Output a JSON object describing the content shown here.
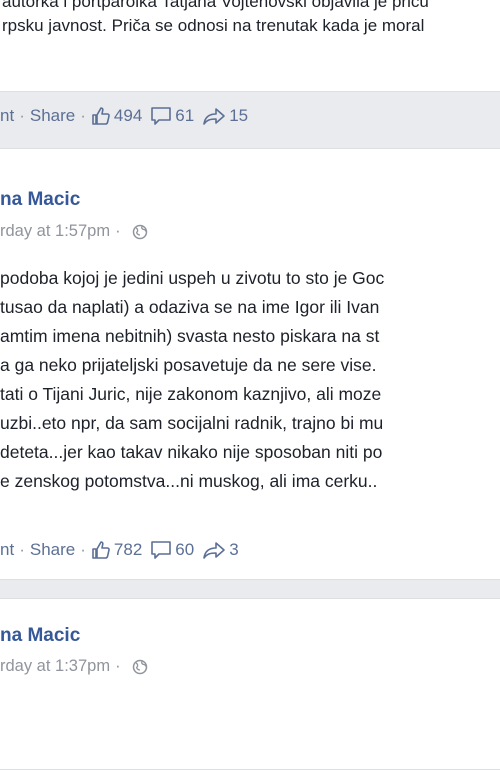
{
  "post_top": {
    "lines": [
      "autorka i portparolka Tatjana Vojtehovski objavila je priču",
      "rpsku javnost. Priča se odnosi na trenutak kada je moral"
    ],
    "actions": {
      "comment_tail": "nt",
      "share": "Share"
    },
    "likes": "494",
    "comments": "61",
    "shares": "15"
  },
  "comment_1": {
    "author": "na Macic",
    "time": "rday at 1:57pm",
    "lines": [
      "podoba kojoj je jedini uspeh u zivotu to sto je Goc",
      "tusao da naplati) a odaziva se na ime Igor ili Ivan",
      "amtim imena nebitnih) svasta nesto piskara na st",
      "a ga neko prijateljski posavetuje da ne sere vise.",
      "tati o Tijani Juric, nije zakonom kaznjivo, ali moze",
      "uzbi..eto npr, da sam socijalni radnik, trajno bi mu",
      "deteta...jer kao takav nikako nije sposoban niti po",
      "e zenskog potomstva...ni muskog, ali ima cerku.."
    ],
    "actions": {
      "comment_tail": "nt",
      "share": "Share"
    },
    "likes": "782",
    "comments": "60",
    "shares": "3"
  },
  "comment_2": {
    "author": "na Macic",
    "time": "rday at 1:37pm"
  },
  "colors": {
    "background": "#e9ebee",
    "link": "#365899",
    "meta": "#90949c"
  },
  "icons": [
    "like-icon",
    "comment-icon",
    "share-icon",
    "globe-icon"
  ]
}
